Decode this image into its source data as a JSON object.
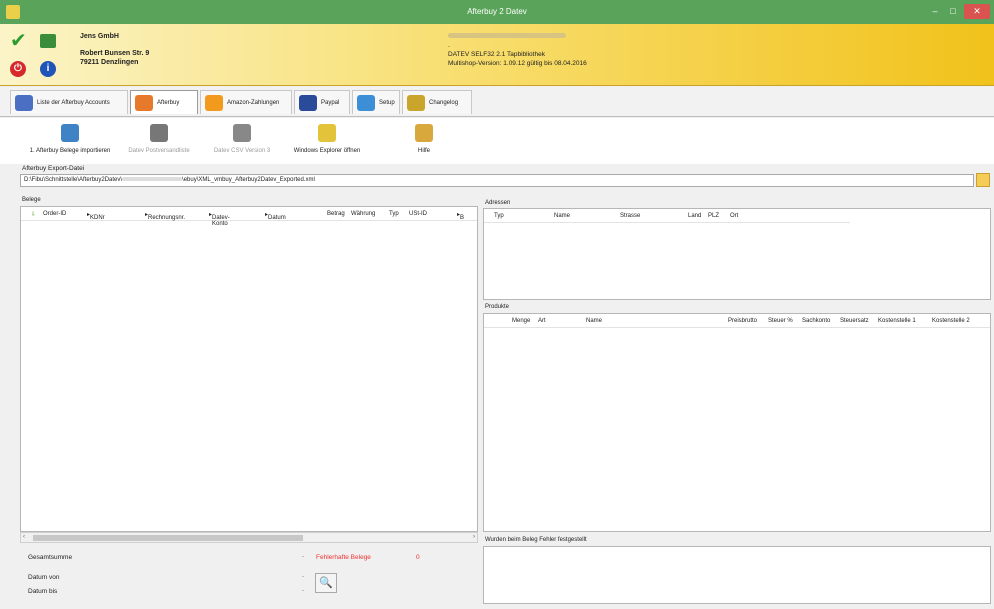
{
  "window": {
    "title": "Afterbuy 2 Datev",
    "minimize": "–",
    "maximize": "□",
    "close": "✕"
  },
  "header": {
    "company": "Jens GmbH",
    "street": "Robert Bunsen Str. 9",
    "city": "79211 Denzlingen",
    "dot": ".",
    "datev_lib": "DATEV SELF32 2.1 Tapbibliothek",
    "version": "Multishop-Version: 1.09.12 gültig bis 08.04.2016"
  },
  "tabs": [
    {
      "label": "Liste der Afterbuy Accounts",
      "color": "#4b6fc2"
    },
    {
      "label": "Afterbuy",
      "color": "#e6792a"
    },
    {
      "label": "Amazon-Zahlungen",
      "color": "#f29a1e"
    },
    {
      "label": "Paypal",
      "color": "#2a4a9a"
    },
    {
      "label": "Setup",
      "color": "#3c8fd6"
    },
    {
      "label": "Changelog",
      "color": "#c9a52b"
    }
  ],
  "toolbar": [
    {
      "label": "1. Afterbuy Belege importieren",
      "color": "#3f82c6"
    },
    {
      "label": "Datev Postversandliste",
      "color": "#777777"
    },
    {
      "label": "Datev CSV Version 3",
      "color": "#888888"
    },
    {
      "label": "Windows Explorer öffnen",
      "color": "#e3c33a"
    },
    {
      "label": "Hilfe",
      "color": "#d9a83c"
    }
  ],
  "export": {
    "label": "Afterbuy Export-Datei",
    "path_start": "D:\\Fibu\\Schnittstelle\\Afterbuy2Datev\\",
    "path_end": "\\ebuy\\XML_vmbuy_Afterbuy2Datev_Exported.xml"
  },
  "belege": {
    "label": "Belege",
    "columns": [
      "Order-ID",
      "KDNr",
      "Rechnungsnr.",
      "Datev-Konto",
      "Datum",
      "Betrag",
      "Währung",
      "Typ",
      "USt-ID",
      "B"
    ]
  },
  "adressen": {
    "label": "Adressen",
    "columns": [
      "Typ",
      "Name",
      "Strasse",
      "Land",
      "PLZ",
      "Ort"
    ]
  },
  "produkte": {
    "label": "Produkte",
    "columns": [
      "Menge",
      "Art",
      "Name",
      "Preisbrutto",
      "Steuer %",
      "Sachkonto",
      "Steuersatz",
      "Kostenstelle 1",
      "Kostenstelle 2"
    ]
  },
  "fehler_panel": {
    "label": "Wurden beim Beleg Fehler festgestellt"
  },
  "summary": {
    "gesamtsumme": "Gesamtsumme",
    "fehlerhafte": "Fehlerhafte Belege",
    "fehler_count": "0",
    "datum_von": "Datum von",
    "datum_bis": "Datum bis",
    "dash": "-"
  }
}
